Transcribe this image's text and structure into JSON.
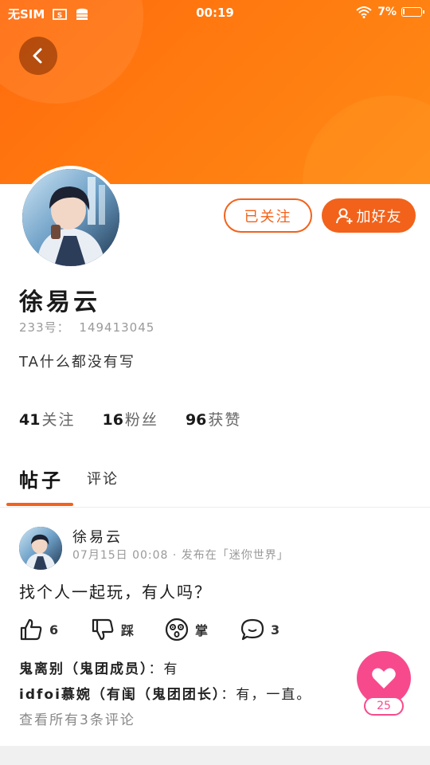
{
  "status_bar": {
    "sim": "无SIM",
    "time": "00:19",
    "battery_text": "7%",
    "battery_level": 0.07
  },
  "profile": {
    "name": "徐易云",
    "uid_label": "233号：",
    "uid": "149413045",
    "bio": "TA什么都没有写",
    "follow_button": "已关注",
    "add_friend_button": "加好友",
    "stats": [
      {
        "num": "41",
        "label": "关注"
      },
      {
        "num": "16",
        "label": "粉丝"
      },
      {
        "num": "96",
        "label": "获赞"
      }
    ]
  },
  "tabs": {
    "posts": "帖子",
    "comments": "评论"
  },
  "post": {
    "author": "徐易云",
    "meta": "07月15日 00:08 · 发布在「迷你世界」",
    "content": "找个人一起玩，有人吗？",
    "like_count": "6",
    "dislike_label": "踩",
    "wow_label": "掌",
    "comment_count": "3",
    "comments": [
      {
        "author": "鬼离别（鬼团成员）",
        "sep": "：",
        "text": "有"
      },
      {
        "author": "idfoi慕婉（有闺（鬼团团长）",
        "sep": "：",
        "text": "有，一直。"
      }
    ],
    "view_all": "查看所有3条评论"
  },
  "floating_like": {
    "count": "25"
  },
  "colors": {
    "accent": "#f2621b",
    "banner": "#ff7a10",
    "like": "#f74a8d"
  }
}
